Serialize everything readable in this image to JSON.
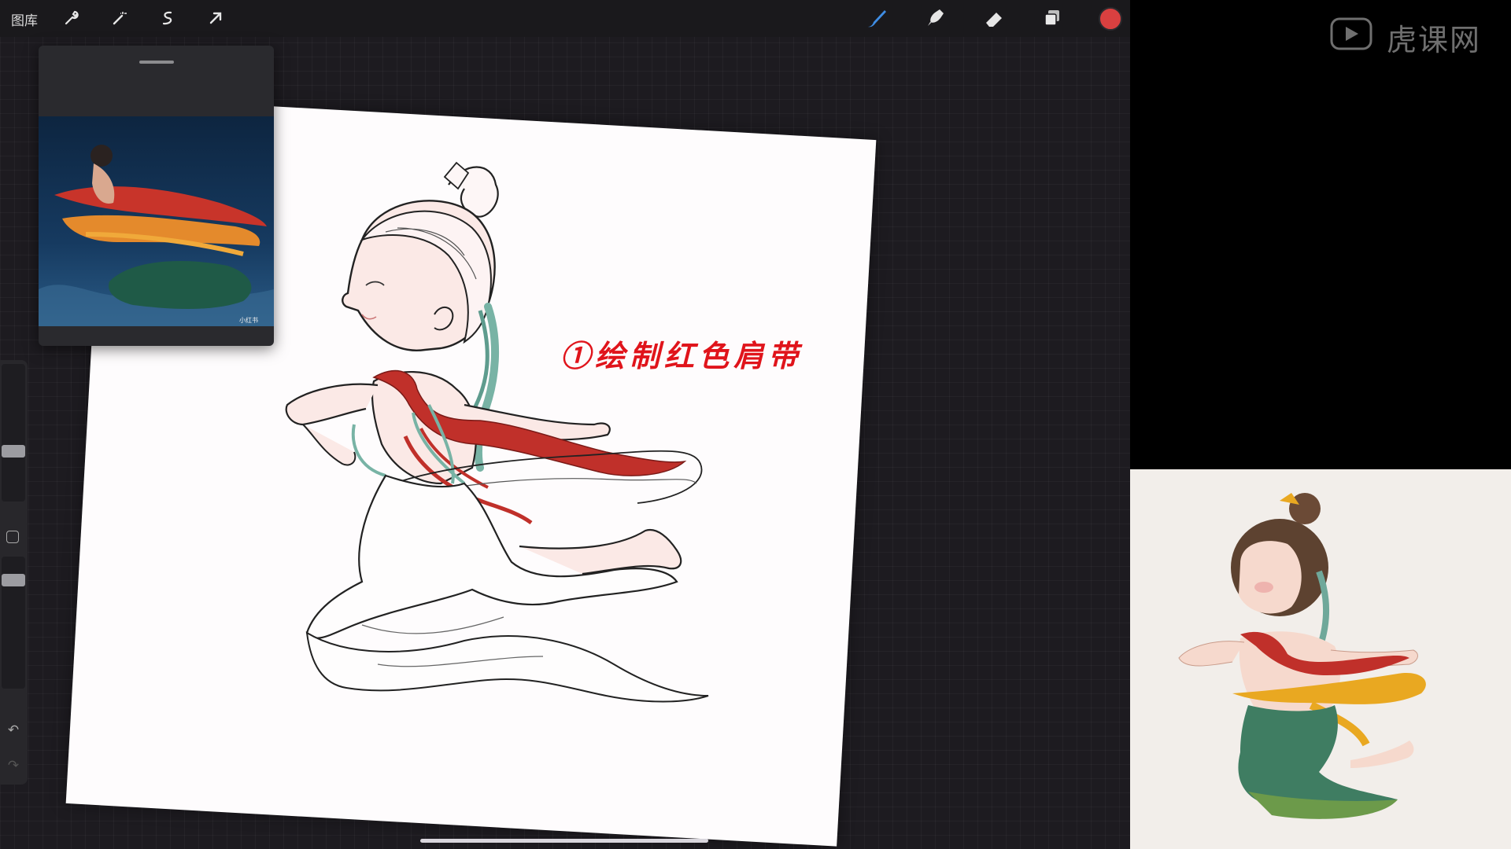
{
  "toolbar": {
    "gallery_label": "图库",
    "tools": [
      "wrench-icon",
      "magic-wand-icon",
      "selection-icon",
      "transform-arrow-icon",
      "brush-icon",
      "smudge-icon",
      "eraser-icon",
      "layers-icon"
    ],
    "current_color": "#d94040"
  },
  "canvas": {
    "caption": "①绘制红色肩带"
  },
  "reference": {
    "watermark": "小红书"
  },
  "branding": {
    "logo_text": "虎课网"
  },
  "colors": {
    "app_bg": "#1d1b20",
    "red_sash": "#c0302a",
    "teal_ribbon": "#78b3a5",
    "skin": "#fbe9e6",
    "caption": "#e0141b",
    "preview_green": "#3f7d62",
    "preview_gold": "#e9a821"
  }
}
